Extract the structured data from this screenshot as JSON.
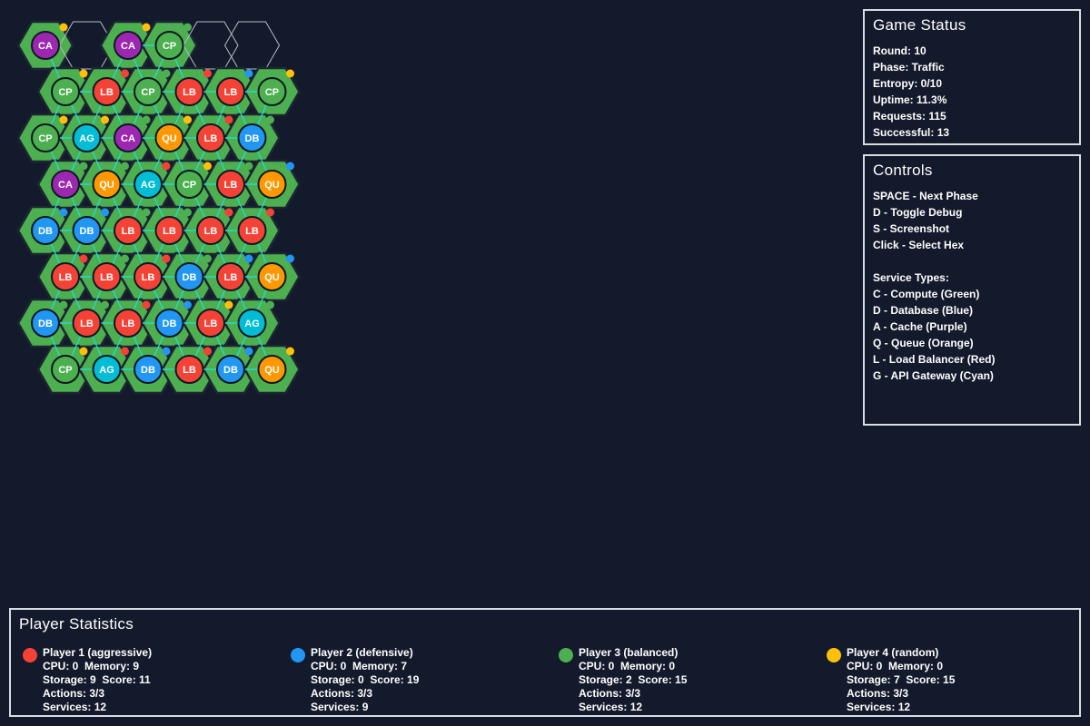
{
  "board": {
    "colors": {
      "hex_fill": "#4caf50",
      "hex_stroke": "#1e2533",
      "connection": "#26d9c9"
    },
    "rows": [
      {
        "offset": false,
        "cells": [
          {
            "label": "CA",
            "svc": "cache",
            "owner": 4
          },
          {
            "label": "",
            "svc": null,
            "owner": null
          },
          {
            "label": "CA",
            "svc": "cache",
            "owner": 4
          },
          {
            "label": "CP",
            "svc": "compute",
            "owner": 3
          },
          {
            "label": "",
            "svc": null,
            "owner": null
          },
          {
            "label": "",
            "svc": null,
            "owner": null
          }
        ]
      },
      {
        "offset": true,
        "cells": [
          {
            "label": "CP",
            "svc": "compute",
            "owner": 4
          },
          {
            "label": "LB",
            "svc": "lb",
            "owner": 1
          },
          {
            "label": "CP",
            "svc": "compute",
            "owner": 3
          },
          {
            "label": "LB",
            "svc": "lb",
            "owner": 1
          },
          {
            "label": "LB",
            "svc": "lb",
            "owner": 2
          },
          {
            "label": "CP",
            "svc": "compute",
            "owner": 4
          }
        ]
      },
      {
        "offset": false,
        "cells": [
          {
            "label": "CP",
            "svc": "compute",
            "owner": 4
          },
          {
            "label": "AG",
            "svc": "gateway",
            "owner": 4
          },
          {
            "label": "CA",
            "svc": "cache",
            "owner": 3
          },
          {
            "label": "QU",
            "svc": "queue",
            "owner": 4
          },
          {
            "label": "LB",
            "svc": "lb",
            "owner": 1
          },
          {
            "label": "DB",
            "svc": "database",
            "owner": 3
          }
        ]
      },
      {
        "offset": true,
        "cells": [
          {
            "label": "CA",
            "svc": "cache",
            "owner": 3
          },
          {
            "label": "QU",
            "svc": "queue",
            "owner": 3
          },
          {
            "label": "AG",
            "svc": "gateway",
            "owner": 1
          },
          {
            "label": "CP",
            "svc": "compute",
            "owner": 4
          },
          {
            "label": "LB",
            "svc": "lb",
            "owner": 3
          },
          {
            "label": "QU",
            "svc": "queue",
            "owner": 2
          }
        ]
      },
      {
        "offset": false,
        "cells": [
          {
            "label": "DB",
            "svc": "database",
            "owner": 2
          },
          {
            "label": "DB",
            "svc": "database",
            "owner": 2
          },
          {
            "label": "LB",
            "svc": "lb",
            "owner": 3
          },
          {
            "label": "LB",
            "svc": "lb",
            "owner": 3
          },
          {
            "label": "LB",
            "svc": "lb",
            "owner": 1
          },
          {
            "label": "LB",
            "svc": "lb",
            "owner": 1
          }
        ]
      },
      {
        "offset": true,
        "cells": [
          {
            "label": "LB",
            "svc": "lb",
            "owner": 1
          },
          {
            "label": "LB",
            "svc": "lb",
            "owner": 3
          },
          {
            "label": "LB",
            "svc": "lb",
            "owner": 1
          },
          {
            "label": "DB",
            "svc": "database",
            "owner": 3
          },
          {
            "label": "LB",
            "svc": "lb",
            "owner": 2
          },
          {
            "label": "QU",
            "svc": "queue",
            "owner": 2
          }
        ]
      },
      {
        "offset": false,
        "cells": [
          {
            "label": "DB",
            "svc": "database",
            "owner": 3
          },
          {
            "label": "LB",
            "svc": "lb",
            "owner": 3
          },
          {
            "label": "LB",
            "svc": "lb",
            "owner": 1
          },
          {
            "label": "DB",
            "svc": "database",
            "owner": 2
          },
          {
            "label": "LB",
            "svc": "lb",
            "owner": 4
          },
          {
            "label": "AG",
            "svc": "gateway",
            "owner": 3
          }
        ]
      },
      {
        "offset": true,
        "cells": [
          {
            "label": "CP",
            "svc": "compute",
            "owner": 4
          },
          {
            "label": "AG",
            "svc": "gateway",
            "owner": 1
          },
          {
            "label": "DB",
            "svc": "database",
            "owner": 2
          },
          {
            "label": "LB",
            "svc": "lb",
            "owner": 1
          },
          {
            "label": "DB",
            "svc": "database",
            "owner": 2
          },
          {
            "label": "QU",
            "svc": "queue",
            "owner": 4
          }
        ]
      }
    ],
    "service_colors": {
      "compute": "#4caf50",
      "database": "#2196f3",
      "cache": "#9c27b0",
      "queue": "#ff9800",
      "lb": "#f44336",
      "gateway": "#00bcd4"
    },
    "owner_colors": {
      "1": "#f44336",
      "2": "#2196f3",
      "3": "#4caf50",
      "4": "#ffc107"
    }
  },
  "status": {
    "title": "Game Status",
    "lines": [
      "Round: 10",
      "Phase: Traffic",
      "Entropy: 0/10",
      "Uptime: 11.3%",
      "Requests: 115",
      "Successful: 13"
    ]
  },
  "controls": {
    "title": "Controls",
    "keys": [
      "SPACE - Next Phase",
      "D - Toggle Debug",
      "S - Screenshot",
      "Click - Select Hex"
    ],
    "types_heading": "Service Types:",
    "types": [
      "C - Compute (Green)",
      "D - Database (Blue)",
      "A - Cache (Purple)",
      "Q - Queue (Orange)",
      "L - Load Balancer (Red)",
      "G - API Gateway (Cyan)"
    ]
  },
  "stats": {
    "title": "Player Statistics",
    "players": [
      {
        "color": "#f44336",
        "name": "Player 1 (aggressive)",
        "line1": "CPU: 0  Memory: 9",
        "line2": "Storage: 9  Score: 11",
        "line3": "Actions: 3/3",
        "line4": "Services: 12"
      },
      {
        "color": "#2196f3",
        "name": "Player 2 (defensive)",
        "line1": "CPU: 0  Memory: 7",
        "line2": "Storage: 0  Score: 19",
        "line3": "Actions: 3/3",
        "line4": "Services: 9"
      },
      {
        "color": "#4caf50",
        "name": "Player 3 (balanced)",
        "line1": "CPU: 0  Memory: 0",
        "line2": "Storage: 2  Score: 15",
        "line3": "Actions: 3/3",
        "line4": "Services: 12"
      },
      {
        "color": "#ffc107",
        "name": "Player 4 (random)",
        "line1": "CPU: 0  Memory: 0",
        "line2": "Storage: 7  Score: 15",
        "line3": "Actions: 3/3",
        "line4": "Services: 12"
      }
    ]
  }
}
